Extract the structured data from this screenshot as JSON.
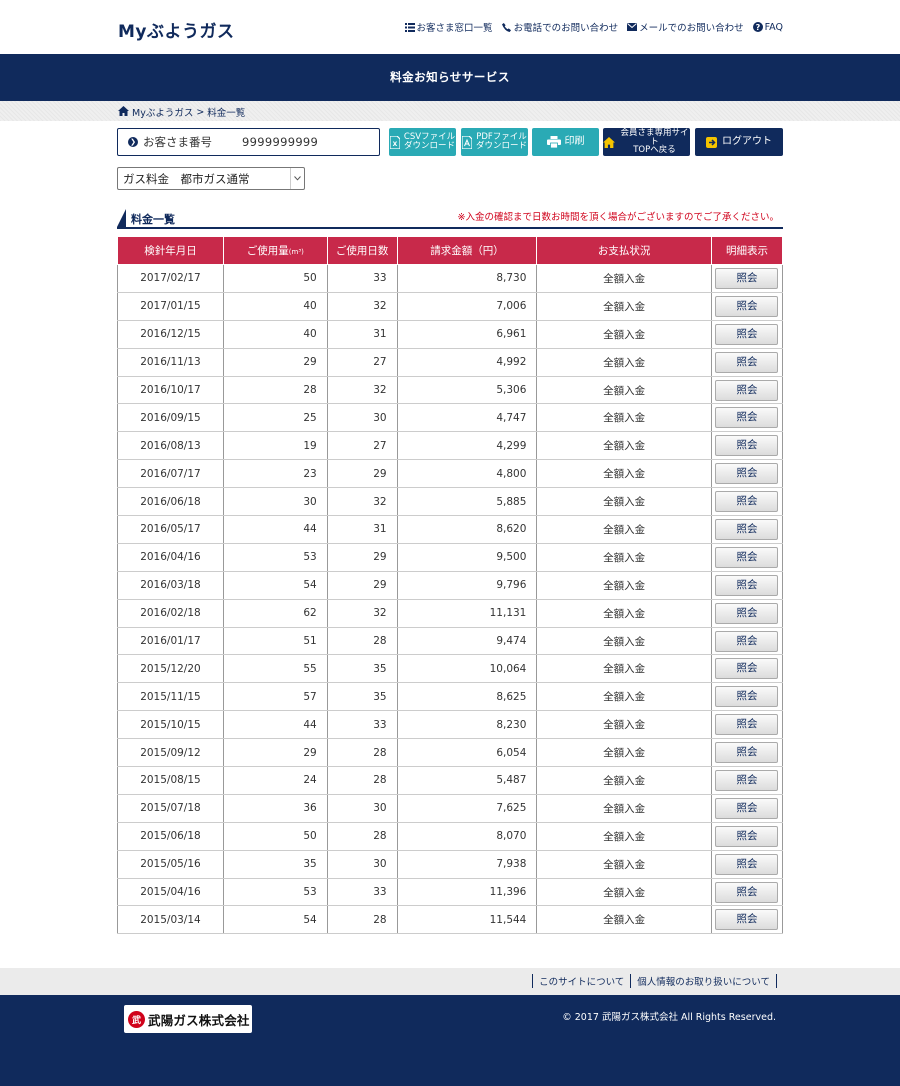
{
  "header": {
    "logo": "Myぶようガス",
    "links": [
      {
        "label": "お客さま窓口一覧",
        "icon": "list-icon"
      },
      {
        "label": "お電話でのお問い合わせ",
        "icon": "phone-icon"
      },
      {
        "label": "メールでのお問い合わせ",
        "icon": "mail-icon"
      },
      {
        "label": "FAQ",
        "icon": "question-icon"
      }
    ]
  },
  "service_title": "料金お知らせサービス",
  "breadcrumb": {
    "home": "Myぶようガス",
    "separator": ">",
    "current": "料金一覧"
  },
  "customer": {
    "label": "お客さま番号",
    "number": "9999999999"
  },
  "buttons": {
    "csv": [
      "CSVファイル",
      "ダウンロード"
    ],
    "pdf": [
      "PDFファイル",
      "ダウンロード"
    ],
    "print": "印刷",
    "member_top": [
      "会員さま専用サイト",
      "TOPへ戻る"
    ],
    "logout": "ログアウト"
  },
  "plan_select": {
    "value": "ガス料金　都市ガス通常"
  },
  "section": {
    "title": "料金一覧",
    "notice": "※入金の確認まで日数お時間を頂く場合がございますのでご了承ください。"
  },
  "table": {
    "headers": {
      "date": "検針年月日",
      "usage": "ご使用量",
      "usage_unit": "(m³)",
      "days": "ご使用日数",
      "amount": "請求金額（円）",
      "status": "お支払状況",
      "detail": "明細表示"
    },
    "view_label": "照会",
    "rows": [
      {
        "date": "2017/02/17",
        "usage": "50",
        "days": "33",
        "amount": "8,730",
        "status": "全額入金"
      },
      {
        "date": "2017/01/15",
        "usage": "40",
        "days": "32",
        "amount": "7,006",
        "status": "全額入金"
      },
      {
        "date": "2016/12/15",
        "usage": "40",
        "days": "31",
        "amount": "6,961",
        "status": "全額入金"
      },
      {
        "date": "2016/11/13",
        "usage": "29",
        "days": "27",
        "amount": "4,992",
        "status": "全額入金"
      },
      {
        "date": "2016/10/17",
        "usage": "28",
        "days": "32",
        "amount": "5,306",
        "status": "全額入金"
      },
      {
        "date": "2016/09/15",
        "usage": "25",
        "days": "30",
        "amount": "4,747",
        "status": "全額入金"
      },
      {
        "date": "2016/08/13",
        "usage": "19",
        "days": "27",
        "amount": "4,299",
        "status": "全額入金"
      },
      {
        "date": "2016/07/17",
        "usage": "23",
        "days": "29",
        "amount": "4,800",
        "status": "全額入金"
      },
      {
        "date": "2016/06/18",
        "usage": "30",
        "days": "32",
        "amount": "5,885",
        "status": "全額入金"
      },
      {
        "date": "2016/05/17",
        "usage": "44",
        "days": "31",
        "amount": "8,620",
        "status": "全額入金"
      },
      {
        "date": "2016/04/16",
        "usage": "53",
        "days": "29",
        "amount": "9,500",
        "status": "全額入金"
      },
      {
        "date": "2016/03/18",
        "usage": "54",
        "days": "29",
        "amount": "9,796",
        "status": "全額入金"
      },
      {
        "date": "2016/02/18",
        "usage": "62",
        "days": "32",
        "amount": "11,131",
        "status": "全額入金"
      },
      {
        "date": "2016/01/17",
        "usage": "51",
        "days": "28",
        "amount": "9,474",
        "status": "全額入金"
      },
      {
        "date": "2015/12/20",
        "usage": "55",
        "days": "35",
        "amount": "10,064",
        "status": "全額入金"
      },
      {
        "date": "2015/11/15",
        "usage": "57",
        "days": "35",
        "amount": "8,625",
        "status": "全額入金"
      },
      {
        "date": "2015/10/15",
        "usage": "44",
        "days": "33",
        "amount": "8,230",
        "status": "全額入金"
      },
      {
        "date": "2015/09/12",
        "usage": "29",
        "days": "28",
        "amount": "6,054",
        "status": "全額入金"
      },
      {
        "date": "2015/08/15",
        "usage": "24",
        "days": "28",
        "amount": "5,487",
        "status": "全額入金"
      },
      {
        "date": "2015/07/18",
        "usage": "36",
        "days": "30",
        "amount": "7,625",
        "status": "全額入金"
      },
      {
        "date": "2015/06/18",
        "usage": "50",
        "days": "28",
        "amount": "8,070",
        "status": "全額入金"
      },
      {
        "date": "2015/05/16",
        "usage": "35",
        "days": "30",
        "amount": "7,938",
        "status": "全額入金"
      },
      {
        "date": "2015/04/16",
        "usage": "53",
        "days": "33",
        "amount": "11,396",
        "status": "全額入金"
      },
      {
        "date": "2015/03/14",
        "usage": "54",
        "days": "28",
        "amount": "11,544",
        "status": "全額入金"
      }
    ]
  },
  "footer": {
    "links": [
      "このサイトについて",
      "個人情報のお取り扱いについて"
    ],
    "corp_name": "武陽ガス株式会社",
    "corp_mark": "武",
    "copyright": "© 2017 武陽ガス株式会社 All Rights Reserved."
  },
  "colors": {
    "navy": "#102a5c",
    "teal": "#2aaab5",
    "header_red": "#c8294a",
    "notice_red": "#d0021b"
  }
}
